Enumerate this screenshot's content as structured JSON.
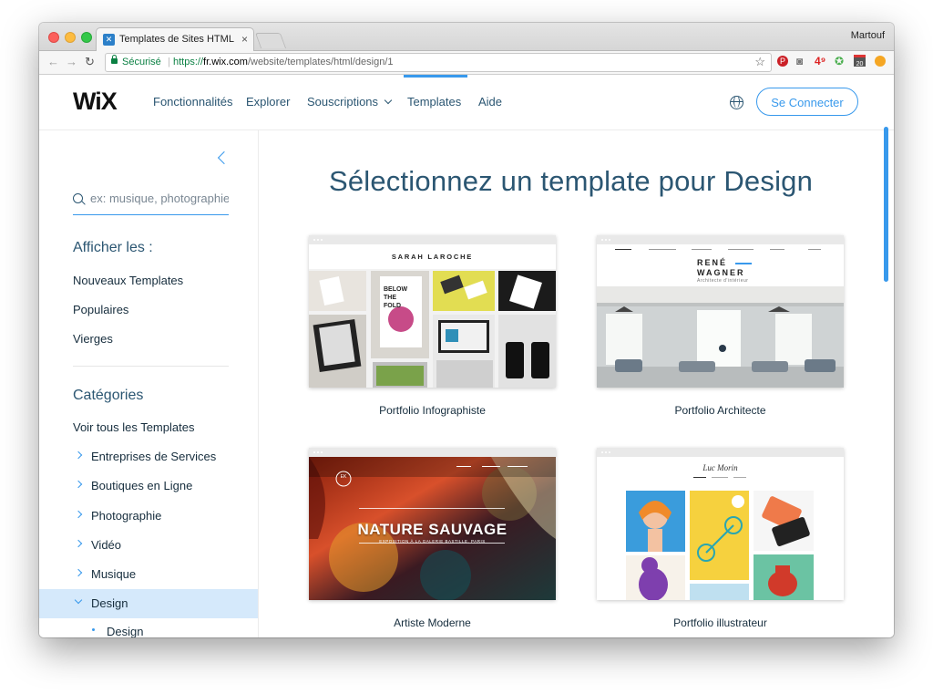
{
  "browser": {
    "tab_title": "Templates de Sites HTML pour",
    "tab_close": "×",
    "profile_name": "Martouf",
    "secure_label": "Sécurisé",
    "url_scheme": "https://",
    "url_host": "fr.wix.com",
    "url_path": "/website/templates/html/design/1",
    "ext_badge": "4⁹",
    "calendar_day": "20"
  },
  "header": {
    "logo": "WiX",
    "nav": [
      "Fonctionnalités",
      "Explorer",
      "Souscriptions",
      "Templates",
      "Aide"
    ],
    "active_nav": "Templates",
    "signin_label": "Se Connecter"
  },
  "sidebar": {
    "search_placeholder": "ex: musique, photographie",
    "show_heading": "Afficher les :",
    "show_links": [
      "Nouveaux Templates",
      "Populaires",
      "Vierges"
    ],
    "categories_heading": "Catégories",
    "all_templates": "Voir tous les Templates",
    "categories": [
      "Entreprises de Services",
      "Boutiques en Ligne",
      "Photographie",
      "Vidéo",
      "Musique",
      "Design"
    ],
    "selected_category": "Design",
    "subcategories": [
      "Design"
    ]
  },
  "main": {
    "title": "Sélectionnez un template pour Design",
    "templates": [
      {
        "label": "Portfolio Infographiste",
        "thumb_title": "SARAH LAROCHE"
      },
      {
        "label": "Portfolio Architecte",
        "thumb_title_1": "RENÉ",
        "thumb_title_2": "WAGNER",
        "thumb_sub": "Architecte d'intérieur"
      },
      {
        "label": "Artiste Moderne",
        "thumb_title": "NATURE SAUVAGE",
        "thumb_sub": "EXPOSITION À LA GALERIE BASTILLE, PARIS",
        "thumb_logo": "EK"
      },
      {
        "label": "Portfolio illustrateur",
        "thumb_title": "Luc Morin"
      }
    ]
  },
  "colors": {
    "accent": "#3899ec",
    "nav_text": "#2b5672",
    "selected_bg": "#d5e9fb"
  }
}
